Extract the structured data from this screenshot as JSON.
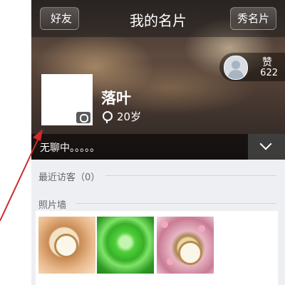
{
  "navbar": {
    "back_label": "好友",
    "title": "我的名片",
    "action_label": "秀名片"
  },
  "like": {
    "label": "赞",
    "count": "622"
  },
  "profile": {
    "name": "落叶",
    "age": "20岁",
    "status": "无聊中。。。。。"
  },
  "sections": {
    "visitors": "最近访客（0）",
    "photo_wall": "照片墙"
  },
  "photos": [
    "pocket-watch",
    "green-rose",
    "pink-blossom-watch"
  ],
  "annotation": {
    "arrow_color": "#d12a2a"
  }
}
